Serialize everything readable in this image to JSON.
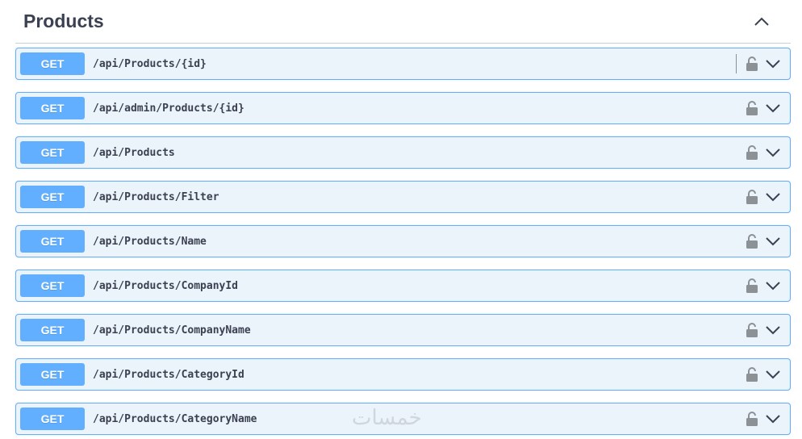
{
  "section": {
    "title": "Products"
  },
  "operations": [
    {
      "method": "GET",
      "path": "/api/Products/{id}"
    },
    {
      "method": "GET",
      "path": "/api/admin/Products/{id}"
    },
    {
      "method": "GET",
      "path": "/api/Products"
    },
    {
      "method": "GET",
      "path": "/api/Products/Filter"
    },
    {
      "method": "GET",
      "path": "/api/Products/Name"
    },
    {
      "method": "GET",
      "path": "/api/Products/CompanyId"
    },
    {
      "method": "GET",
      "path": "/api/Products/CompanyName"
    },
    {
      "method": "GET",
      "path": "/api/Products/CategoryId"
    },
    {
      "method": "GET",
      "path": "/api/Products/CategoryName"
    }
  ],
  "icons": {
    "collapse": "chevron-up-icon",
    "lock": "lock-icon",
    "expand": "chevron-down-icon"
  },
  "colors": {
    "get": "#61affe",
    "get_bg": "#ebf3fb",
    "title": "#3b4151"
  },
  "watermark": "خمسات"
}
